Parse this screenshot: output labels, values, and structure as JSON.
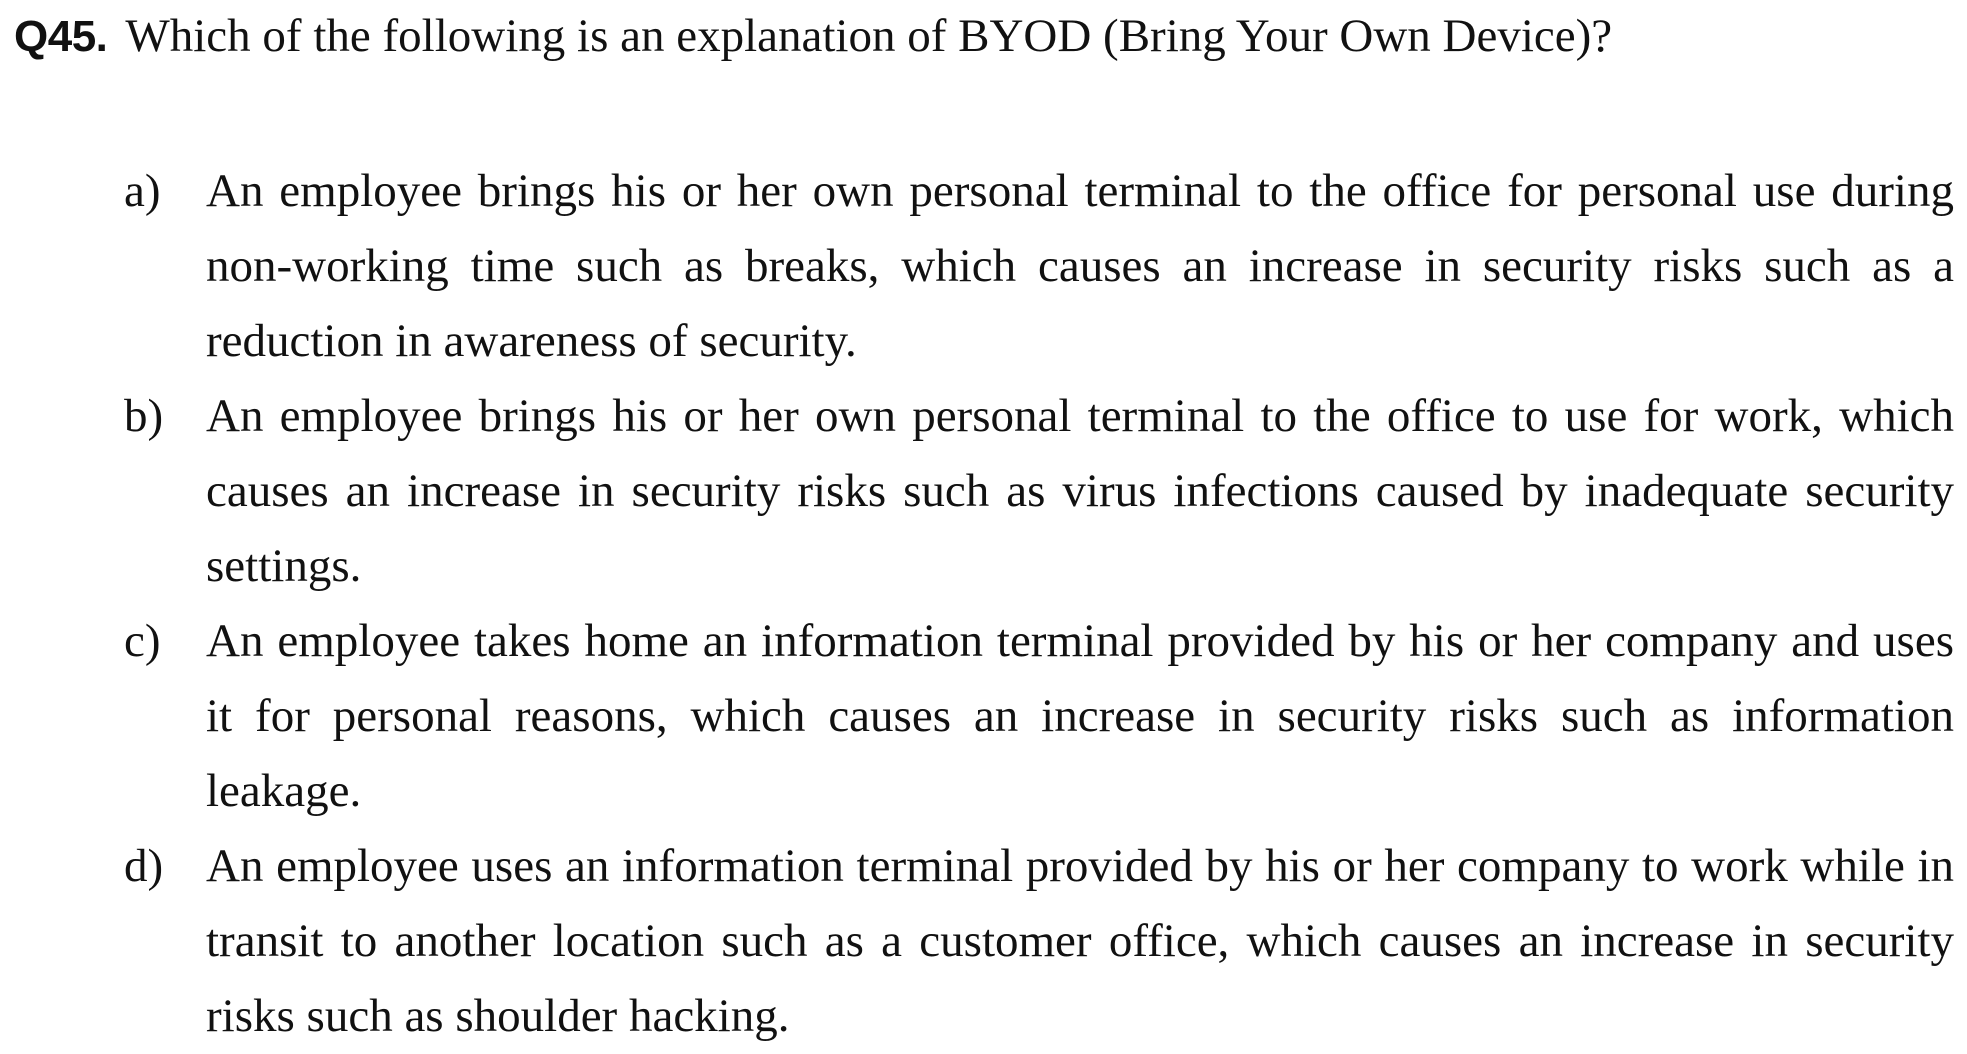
{
  "question": {
    "number": "Q45.",
    "text": "Which of the following is an explanation of  BYOD (Bring Your Own Device)?"
  },
  "options": [
    {
      "label": "a)",
      "text": "An employee brings his or her own personal terminal to the office for personal use during non-working time such as breaks, which causes an increase in security risks such as a reduction in awareness of security."
    },
    {
      "label": "b)",
      "text": "An employee brings his or her own personal terminal to the office to use for work, which causes an increase in security risks such as virus infections caused by inadequate security settings."
    },
    {
      "label": "c)",
      "text": "An employee takes home an information terminal provided by his or her company and uses it for personal reasons, which causes an increase in security risks such as information leakage."
    },
    {
      "label": "d)",
      "text": "An employee uses an information terminal provided by his or her company to work while in transit to another location such as a customer office, which causes an increase in security risks such as shoulder hacking."
    }
  ]
}
